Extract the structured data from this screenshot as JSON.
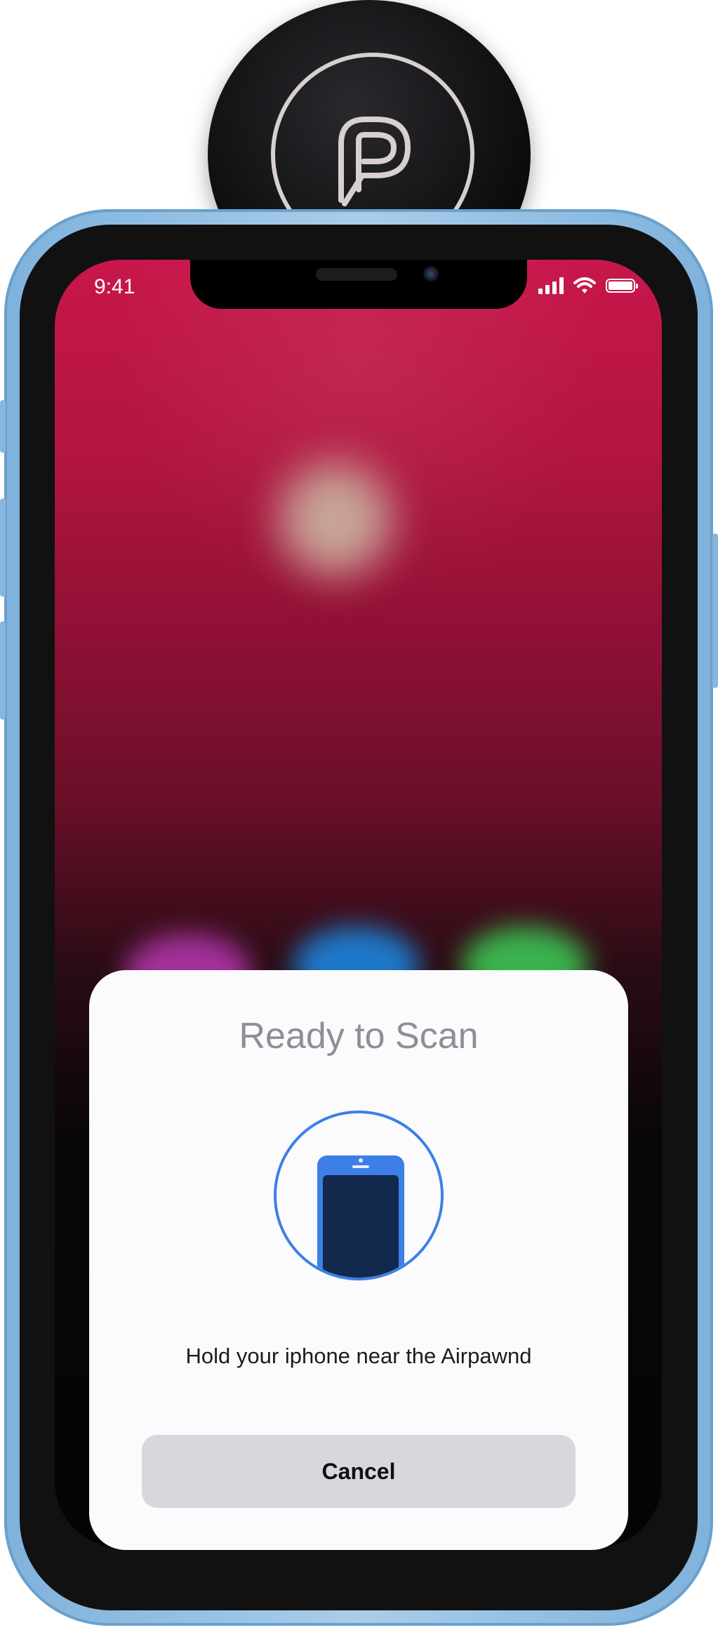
{
  "status_bar": {
    "time": "9:41"
  },
  "nfc_sheet": {
    "title": "Ready to Scan",
    "message": "Hold your iphone near the Airpawnd",
    "cancel_label": "Cancel"
  },
  "colors": {
    "accent_blue": "#3d7fe6",
    "wallpaper_top": "#c8174b",
    "phone_frame": "#8fbce2",
    "sheet_background": "#fbfbfd"
  },
  "icons": [
    "airpawnd-logo-icon",
    "cellular-signal-icon",
    "wifi-icon",
    "battery-icon",
    "phone-scan-icon"
  ]
}
